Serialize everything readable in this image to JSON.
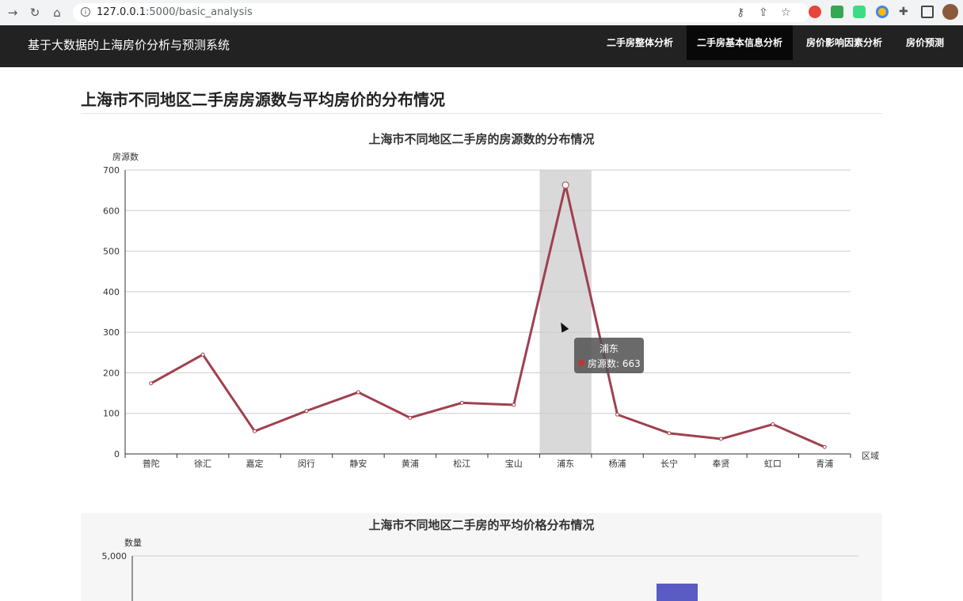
{
  "browser": {
    "url_host": "127.0.0.1",
    "url_path": ":5000/basic_analysis"
  },
  "navbar": {
    "brand": "基于大数据的上海房价分析与预测系统",
    "items": [
      {
        "label": "二手房整体分析",
        "active": false
      },
      {
        "label": "二手房基本信息分析",
        "active": true
      },
      {
        "label": "房价影响因素分析",
        "active": false
      },
      {
        "label": "房价预测",
        "active": false
      }
    ]
  },
  "page": {
    "title": "上海市不同地区二手房房源数与平均房价的分布情况"
  },
  "tooltip": {
    "title": "浦东",
    "series": "房源数",
    "value": "663"
  },
  "colors": {
    "line": "#a0404f",
    "highlight": "#d9d9d9",
    "tooltip_dot": "#c23531",
    "bar": "#5b5bc4"
  },
  "chart_data": [
    {
      "type": "line",
      "title": "上海市不同地区二手房的房源数的分布情况",
      "xlabel": "区域",
      "ylabel": "房源数",
      "ylim": [
        0,
        700
      ],
      "yticks": [
        "0",
        "100",
        "200",
        "300",
        "400",
        "500",
        "600",
        "700"
      ],
      "categories": [
        "普陀",
        "徐汇",
        "嘉定",
        "闵行",
        "静安",
        "黄浦",
        "松江",
        "宝山",
        "浦东",
        "杨浦",
        "长宁",
        "奉贤",
        "虹口",
        "青浦"
      ],
      "series": [
        {
          "name": "房源数",
          "values": [
            174,
            245,
            56,
            106,
            152,
            89,
            126,
            121,
            663,
            97,
            51,
            37,
            73,
            17
          ]
        }
      ],
      "highlighted_category": "浦东",
      "grid": true
    },
    {
      "type": "bar",
      "title": "上海市不同地区二手房的平均价格分布情况",
      "ylabel": "数量",
      "yticks": [
        "5,000"
      ],
      "ylim": [
        0,
        5000
      ],
      "grid": true
    }
  ]
}
